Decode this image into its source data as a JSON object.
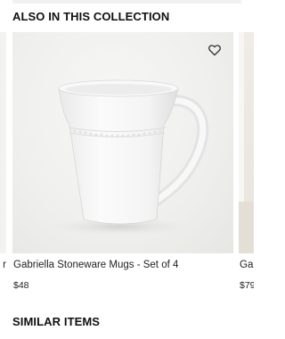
{
  "sections": {
    "also_in_collection_title": "ALSO IN THIS COLLECTION",
    "similar_items_title": "SIMILAR ITEMS"
  },
  "carousel": {
    "left_partial": {
      "name_fragment": "r"
    },
    "main": {
      "name": "Gabriella Stoneware Mugs - Set of 4",
      "price": "$48",
      "wishlist_icon": "heart-outline-icon"
    },
    "right_partial": {
      "name_fragment": "Gal",
      "price_fragment": "$79"
    }
  },
  "colors": {
    "text": "#1a1a1a",
    "image_background": "#efefed"
  }
}
